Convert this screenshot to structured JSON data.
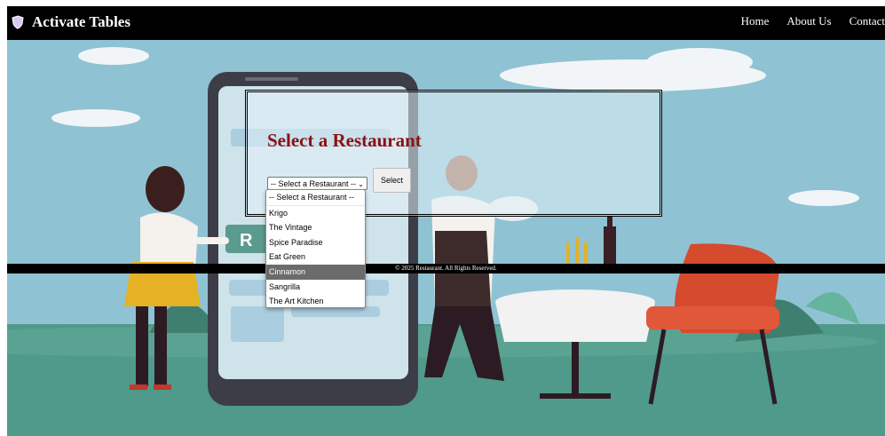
{
  "header": {
    "brand": "Activate Tables",
    "nav": [
      "Home",
      "About Us",
      "Contact"
    ]
  },
  "panel": {
    "title": "Select a Restaurant",
    "select_value": "-- Select a Restaurant --",
    "button_label": "Select"
  },
  "dropdown": {
    "options": [
      "-- Select a Restaurant --",
      "Krigo",
      "The Vintage",
      "Spice Paradise",
      "Eat Green",
      "Cinnamon",
      "Sangrilla",
      "The Art Kitchen"
    ],
    "highlighted": "Cinnamon"
  },
  "footer": {
    "text": "© 2025 Restaurant. All Rights Reserved."
  },
  "colors": {
    "title": "#8b1212",
    "header_bg": "#000000",
    "sky": "#8fc3d3",
    "grass": "#4f9a8a"
  }
}
